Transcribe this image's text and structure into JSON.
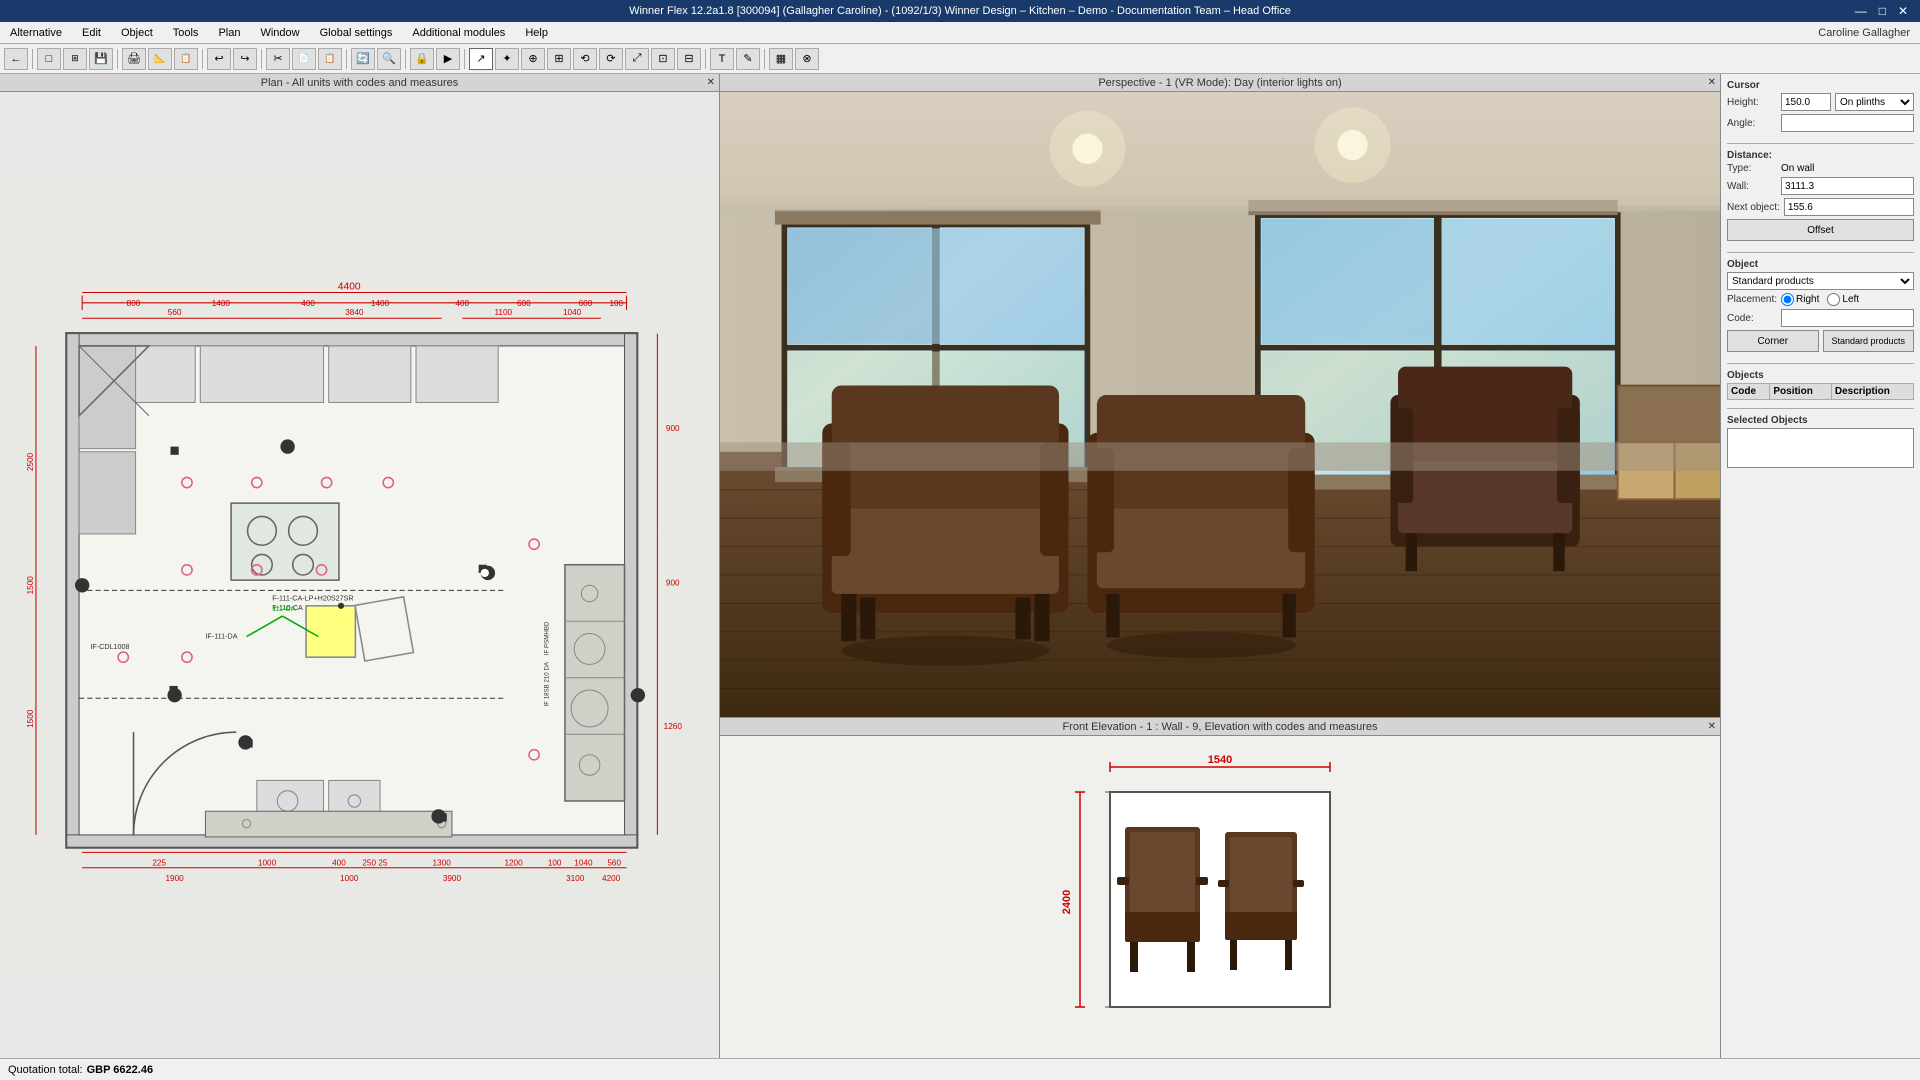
{
  "titleBar": {
    "text": "Winner Flex 12.2a1.8  [300094]  (Gallagher Caroline) - (1092/1/3) Winner Design – Kitchen – Demo - Documentation Team – Head Office",
    "controls": [
      "—",
      "□",
      "✕"
    ]
  },
  "menuBar": {
    "items": [
      "Alternative",
      "Edit",
      "Object",
      "Tools",
      "Plan",
      "Window",
      "Global settings",
      "Additional modules",
      "Help"
    ],
    "userLabel": "Caroline Gallagher"
  },
  "panels": {
    "plan": {
      "title": "Plan - All units with codes and measures",
      "closeBtn": "✕"
    },
    "perspective": {
      "title": "Perspective - 1 (VR Mode): Day (interior lights on)",
      "closeBtn": "✕"
    },
    "elevation": {
      "title": "Front Elevation - 1 : Wall - 9, Elevation with codes and measures",
      "closeBtn": "✕",
      "dimensionTop": "1540",
      "dimensionLeft": "2400"
    }
  },
  "cursor": {
    "sectionLabel": "Cursor",
    "heightLabel": "Height:",
    "heightValue": "150.0",
    "heightDropdown": "On plinths",
    "angleLabel": "Angle:",
    "angleValue": ""
  },
  "distance": {
    "sectionLabel": "Distance:",
    "typeLabel": "Type:",
    "typeValue": "On wall",
    "wallLabel": "Wall:",
    "wallValue": "3111.3",
    "nextObjectLabel": "Next object:",
    "nextObjectValue": "155.6",
    "offsetBtn": "Offset"
  },
  "object": {
    "sectionLabel": "Object",
    "selectValue": "Standard products",
    "placementLabel": "Placement:",
    "placementRight": "Right",
    "placementLeft": "Left",
    "codeLabel": "Code:",
    "codeValue": "",
    "cornerBtn": "Corner",
    "standardProductsBtn": "Standard products"
  },
  "objects": {
    "sectionLabel": "Objects",
    "columns": [
      "Code",
      "Position",
      "Description"
    ],
    "rows": []
  },
  "selectedObjects": {
    "sectionLabel": "Selected Objects"
  },
  "statusBar": {
    "quotationLabel": "Quotation total:",
    "quotationValue": "GBP 6622.46"
  },
  "toolbar": {
    "buttons": [
      "←",
      "□",
      "⊞",
      "⊟",
      "💾",
      "🖨",
      "📐",
      "📋",
      "↩",
      "↪",
      "✂",
      "📄",
      "📋",
      "🔄",
      "🔍",
      "📧",
      "🔒",
      "▶",
      "⚙",
      "✎",
      "T",
      "✦",
      "↺",
      "⊙",
      "●",
      "○",
      "⊕",
      "⊞",
      "⊟",
      "□",
      "▦",
      "⟲",
      "⟳",
      "⤢",
      "⊡",
      "⊟",
      "⊗",
      "🖊"
    ]
  }
}
